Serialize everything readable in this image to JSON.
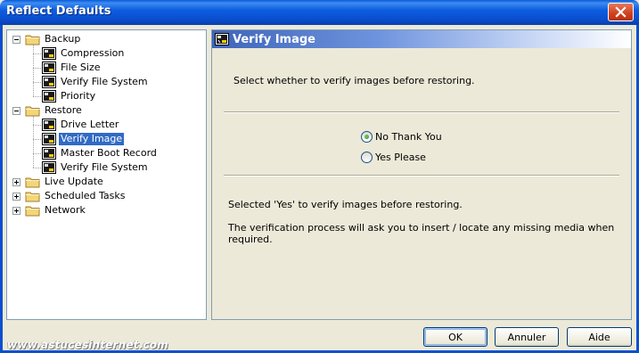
{
  "window": {
    "title": "Reflect Defaults"
  },
  "tree": [
    {
      "label": "Backup",
      "level": 0,
      "type": "folder",
      "expander": "minus"
    },
    {
      "label": "Compression",
      "level": 1,
      "type": "item"
    },
    {
      "label": "File Size",
      "level": 1,
      "type": "item"
    },
    {
      "label": "Verify File System",
      "level": 1,
      "type": "item"
    },
    {
      "label": "Priority",
      "level": 1,
      "type": "item"
    },
    {
      "label": "Restore",
      "level": 0,
      "type": "folder",
      "expander": "minus"
    },
    {
      "label": "Drive Letter",
      "level": 1,
      "type": "item"
    },
    {
      "label": "Verify Image",
      "level": 1,
      "type": "item",
      "selected": true
    },
    {
      "label": "Master Boot Record",
      "level": 1,
      "type": "item"
    },
    {
      "label": "Verify File System",
      "level": 1,
      "type": "item"
    },
    {
      "label": "Live Update",
      "level": 0,
      "type": "folder",
      "expander": "plus"
    },
    {
      "label": "Scheduled Tasks",
      "level": 0,
      "type": "folder",
      "expander": "plus"
    },
    {
      "label": "Network",
      "level": 0,
      "type": "folder",
      "expander": "plus"
    }
  ],
  "panel": {
    "title": "Verify Image",
    "description": "Select whether to verify images before restoring.",
    "options": [
      {
        "label": "No Thank You",
        "checked": true
      },
      {
        "label": "Yes Please",
        "checked": false
      }
    ],
    "info_line1": "Selected 'Yes' to verify images before restoring.",
    "info_line2": "The verification process will ask you to insert / locate any missing media when required."
  },
  "buttons": {
    "ok": "OK",
    "cancel": "Annuler",
    "help": "Aide"
  },
  "watermark": "www.astucesinternet.com",
  "colors": {
    "titlebar": "#0a4fd0",
    "selection": "#316ac5",
    "header_gradient_start": "#3d64b9"
  }
}
